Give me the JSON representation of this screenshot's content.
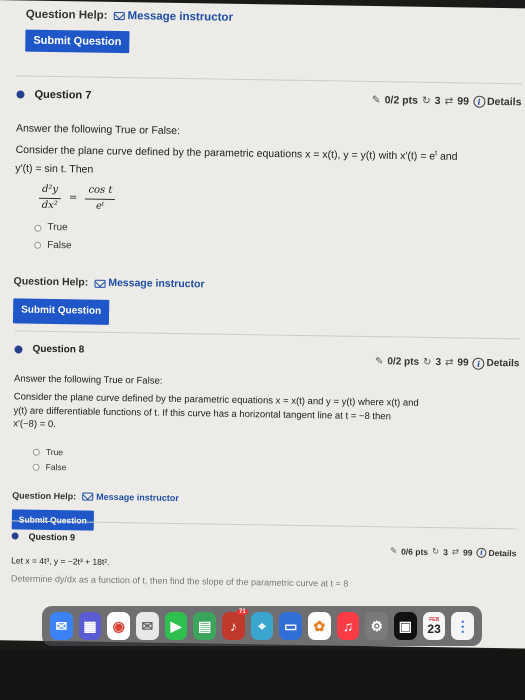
{
  "top_help": {
    "label": "Question Help:",
    "message_link": "Message instructor"
  },
  "top_submit": "Submit Question",
  "q7": {
    "title": "Question 7",
    "pts": "0/2 pts",
    "retries": "3",
    "attempts": "99",
    "details": "Details",
    "instruction": "Answer the following True or False:",
    "prompt": "Consider the plane curve defined by the parametric equations x = x(t), y = y(t) with x′(t) = e",
    "prompt_sup": "t",
    "prompt2": " and",
    "prompt_line2": "y′(t) = sin t. Then",
    "lhs_num": "d²y",
    "lhs_den": "dx²",
    "eq": "=",
    "rhs_num": "cos t",
    "rhs_den": "eᵗ",
    "opt_true": "True",
    "opt_false": "False",
    "help_label": "Question Help:",
    "help_link": "Message instructor",
    "submit": "Submit Question"
  },
  "q8": {
    "title": "Question 8",
    "pts": "0/2 pts",
    "retries": "3",
    "attempts": "99",
    "details": "Details",
    "instruction": "Answer the following True or False:",
    "prompt": "Consider the plane curve defined by the parametric equations x = x(t) and y = y(t) where x(t) and",
    "prompt_line2": "y(t) are differentiable functions of t. If this curve has a horizontal tangent line at t = −8 then",
    "prompt_line3": "x′(−8) = 0.",
    "opt_true": "True",
    "opt_false": "False",
    "help_label": "Question Help:",
    "help_link": "Message instructor",
    "submit": "Submit Question"
  },
  "q9": {
    "title": "Question 9",
    "pts": "0/6 pts",
    "retries": "3",
    "attempts": "99",
    "details": "Details",
    "prompt": "Let x = 4t³, y = −2t³ + 18t².",
    "prompt_line2": "Determine dy/dx as a function of t, then find the slope of the parametric curve at t = 8"
  },
  "dock": {
    "calendar_month": "FEB",
    "calendar_day": "23",
    "badge": "71"
  }
}
